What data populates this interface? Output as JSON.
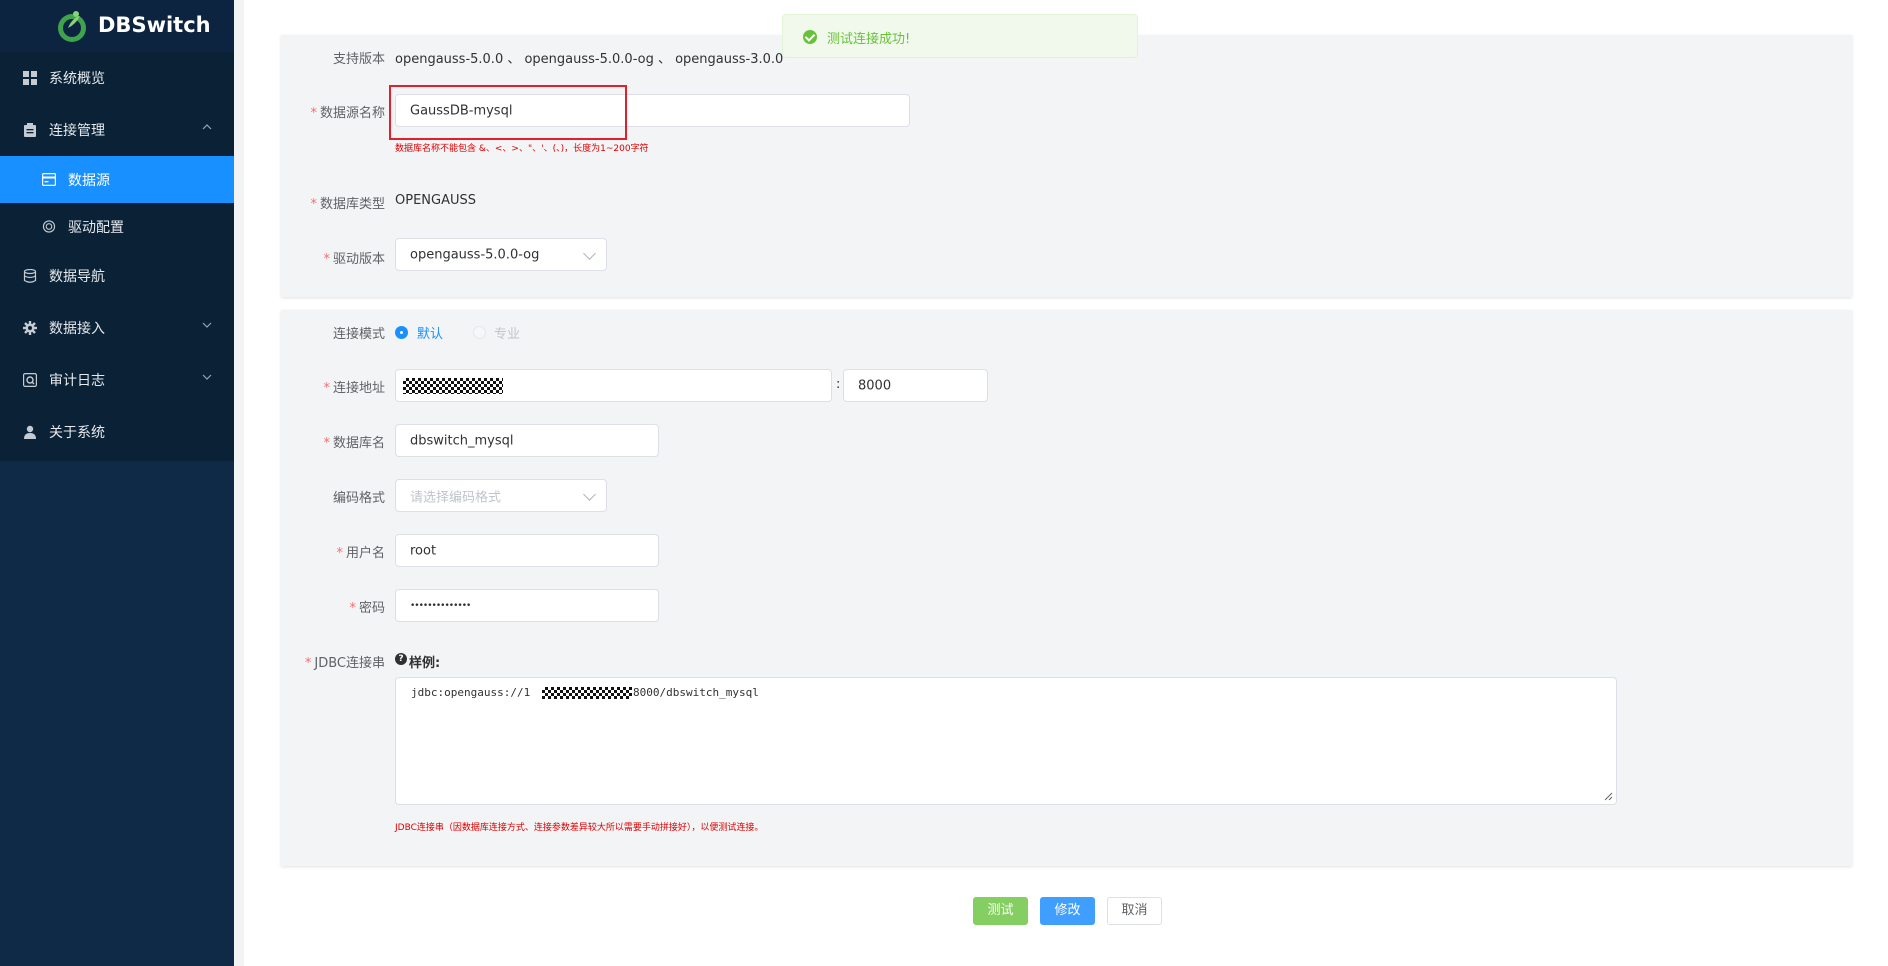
{
  "app": {
    "name": "DBSwitch"
  },
  "sidebar": {
    "items": [
      {
        "label": "系统概览",
        "icon": "grid-icon"
      },
      {
        "label": "连接管理",
        "icon": "clipboard-icon",
        "expanded": true,
        "children": [
          {
            "label": "数据源",
            "icon": "card-icon",
            "active": true
          },
          {
            "label": "驱动配置",
            "icon": "lifebuoy-icon"
          }
        ]
      },
      {
        "label": "数据导航",
        "icon": "database-icon"
      },
      {
        "label": "数据接入",
        "icon": "gear-icon"
      },
      {
        "label": "审计日志",
        "icon": "log-icon"
      },
      {
        "label": "关于系统",
        "icon": "user-icon"
      }
    ]
  },
  "toast": {
    "message": "测试连接成功!",
    "type": "success",
    "color": "#67c23a"
  },
  "form_basic": {
    "supported_versions_label": "支持版本",
    "supported_versions": "opengauss-5.0.0 、 opengauss-5.0.0-og 、 opengauss-3.0.0",
    "name_label": "数据源名称",
    "name_value": "GaussDB-mysql",
    "name_hint": "数据库名称不能包含 &、<、>、\"、'、(、)，长度为1~200字符",
    "dbtype_label": "数据库类型",
    "dbtype_value": "OPENGAUSS",
    "driver_label": "驱动版本",
    "driver_value": "opengauss-5.0.0-og"
  },
  "form_conn": {
    "mode_label": "连接模式",
    "mode_default": "默认",
    "mode_pro": "专业",
    "address_label": "连接地址",
    "port_separator": ":",
    "port_value": "8000",
    "dbname_label": "数据库名",
    "dbname_value": "dbswitch_mysql",
    "encoding_label": "编码格式",
    "encoding_placeholder": "请选择编码格式",
    "username_label": "用户名",
    "username_value": "root",
    "password_label": "密码",
    "password_value": "••••••••••••••",
    "jdbc_label": "JDBC连接串",
    "jdbc_example_label": "样例:",
    "jdbc_prefix": "jdbc:opengauss://1",
    "jdbc_suffix": "8000/dbswitch_mysql",
    "jdbc_hint": "JDBC连接串（因数据库连接方式、连接参数差异较大所以需要手动拼接好），以便测试连接。"
  },
  "actions": {
    "test": "测试",
    "edit": "修改",
    "cancel": "取消"
  },
  "colors": {
    "sidebar_bg": "#0e2a47",
    "active": "#1890ff",
    "required": "#f56c6c",
    "error_hint": "#e00000"
  }
}
